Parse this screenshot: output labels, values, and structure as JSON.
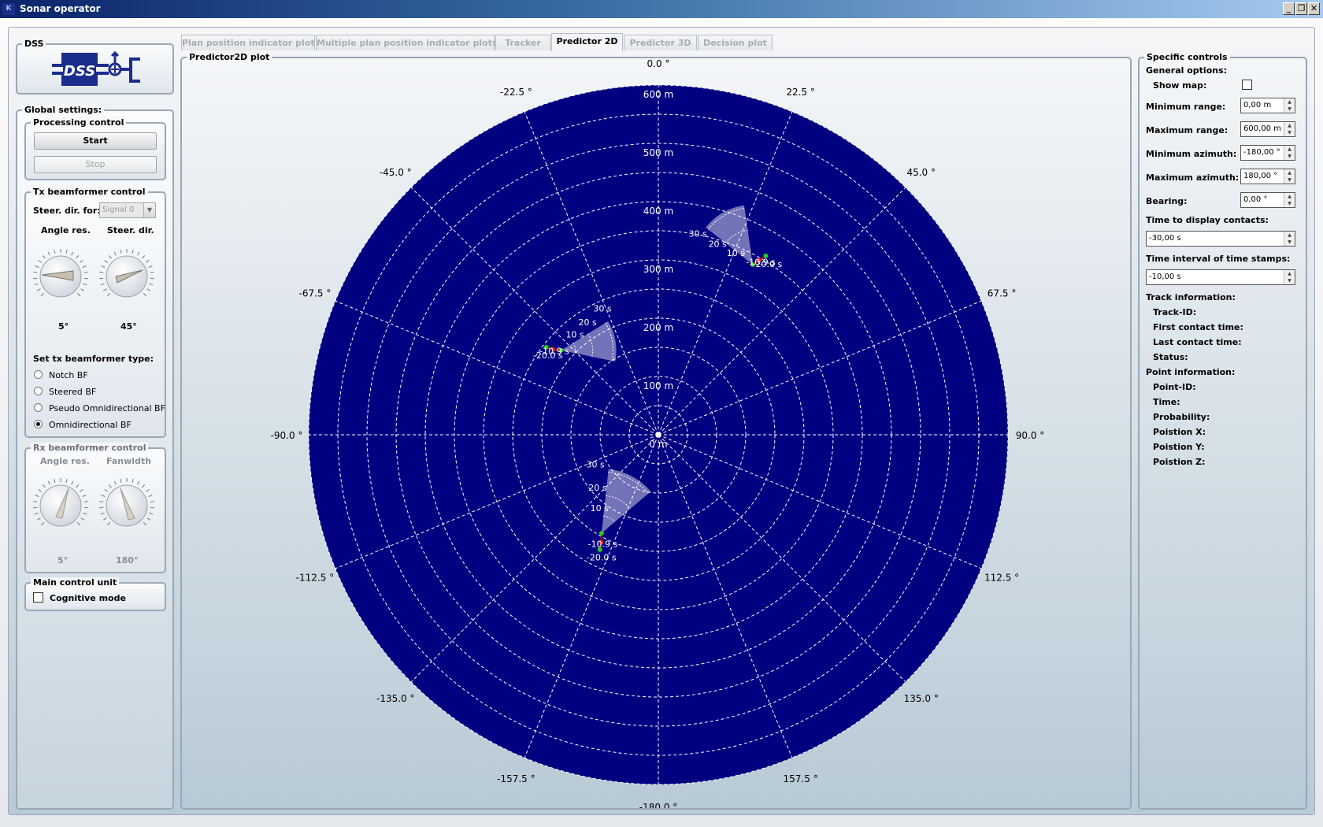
{
  "window": {
    "title": "Sonar operator",
    "icon": "app-icon"
  },
  "left": {
    "dss_title": "DSS",
    "logo_text": "DSS",
    "global_title": "Global settings:",
    "processing": {
      "title": "Processing control",
      "start": "Start",
      "stop": "Stop"
    },
    "tx": {
      "title": "Tx beamformer control",
      "steer_for_label": "Steer. dir. for:",
      "steer_for_value": "Signal 0",
      "angle_res_label": "Angle res.",
      "steer_dir_label": "Steer. dir.",
      "angle_res_value": "5°",
      "steer_dir_value": "45°",
      "type_label": "Set tx beamformer type:",
      "types": [
        "Notch BF",
        "Steered BF",
        "Pseudo Omnidirectional BF",
        "Omnidirectional BF"
      ],
      "selected_type": "Omnidirectional BF"
    },
    "rx": {
      "title": "Rx beamformer control",
      "angle_res_label": "Angle res.",
      "fanwidth_label": "Fanwidth",
      "angle_res_value": "5°",
      "fanwidth_value": "180°"
    },
    "mcu": {
      "title": "Main control unit",
      "cognitive_label": "Cognitive mode",
      "cognitive_checked": false
    }
  },
  "tabs": [
    {
      "label": "Plan position indicator plot",
      "active": false
    },
    {
      "label": "Multiple plan position indicator plots",
      "active": false
    },
    {
      "label": "Tracker",
      "active": false
    },
    {
      "label": "Predictor 2D",
      "active": true
    },
    {
      "label": "Predictor 3D",
      "active": false
    },
    {
      "label": "Decision plot",
      "active": false
    }
  ],
  "plot": {
    "title": "Predictor2D plot",
    "background": "#000080",
    "range_labels": [
      "0 m",
      "100 m",
      "200 m",
      "300 m",
      "400 m",
      "500 m",
      "600 m"
    ],
    "range_values": [
      0,
      100,
      200,
      300,
      400,
      500,
      600
    ],
    "max_range": 600,
    "angle_labels": [
      "0.0 °",
      "22.5 °",
      "45.0 °",
      "67.5 °",
      "90.0 °",
      "112.5 °",
      "135.0 °",
      "157.5 °",
      "-180.0 °",
      "-157.5 °",
      "-135.0 °",
      "-112.5 °",
      "-90.0 °",
      "-67.5 °",
      "-45.0 °",
      "-22.5 °"
    ],
    "angle_values": [
      0,
      22.5,
      45,
      67.5,
      90,
      112.5,
      135,
      157.5,
      180,
      -157.5,
      -135,
      -112.5,
      -90,
      -67.5,
      -45,
      -22.5
    ],
    "tracks": [
      {
        "points": [
          {
            "az": 29,
            "r": 334
          },
          {
            "az": 30,
            "r": 346
          },
          {
            "az": 31,
            "r": 358
          }
        ],
        "labels": [
          "-10.9 s",
          "-20.0 s"
        ],
        "pred_labels": [
          "10 s",
          "20 s",
          "30 s"
        ],
        "cone_dir": -120,
        "pred_dist": [
          18,
          44,
          72
        ]
      },
      {
        "points": [
          {
            "az": -49,
            "r": 221
          },
          {
            "az": -51,
            "r": 233
          },
          {
            "az": -52,
            "r": 244
          }
        ],
        "labels": [
          "-10.9 s",
          "-20.0 s"
        ],
        "pred_labels": [
          "10 s",
          "20 s",
          "30 s"
        ],
        "cone_dir": -10,
        "pred_dist": [
          18,
          40,
          66
        ]
      },
      {
        "points": [
          {
            "az": -150,
            "r": 195
          },
          {
            "az": -152,
            "r": 209
          },
          {
            "az": -153,
            "r": 221
          }
        ],
        "labels": [
          "-10.9 s",
          "-20.0 s"
        ],
        "pred_labels": [
          "10 s",
          "20 s",
          "30 s"
        ],
        "cone_dir": -62,
        "pred_dist": [
          22,
          48,
          78
        ]
      }
    ]
  },
  "right": {
    "title": "Specific controls",
    "general_label": "General options:",
    "show_map_label": "Show map:",
    "show_map_checked": false,
    "min_range_label": "Minimum range:",
    "min_range_value": "0,00 m",
    "max_range_label": "Maximum range:",
    "max_range_value": "600,00 m",
    "min_az_label": "Minimum azimuth:",
    "min_az_value": "-180,00 °",
    "max_az_label": "Maximum azimuth:",
    "max_az_value": "180,00 °",
    "bearing_label": "Bearing:",
    "bearing_value": "0,00 °",
    "time_contacts_label": "Time to display contacts:",
    "time_contacts_value": "-30,00 s",
    "time_interval_label": "Time interval of time stamps:",
    "time_interval_value": "-10,00 s",
    "track_info_label": "Track information:",
    "track_fields": [
      "Track-ID:",
      "First contact time:",
      "Last contact time:",
      "Status:"
    ],
    "point_info_label": "Point information:",
    "point_fields": [
      "Point-ID:",
      "Time:",
      "Probability:",
      "Poistion X:",
      "Poistion Y:",
      "Poistion Z:"
    ]
  }
}
